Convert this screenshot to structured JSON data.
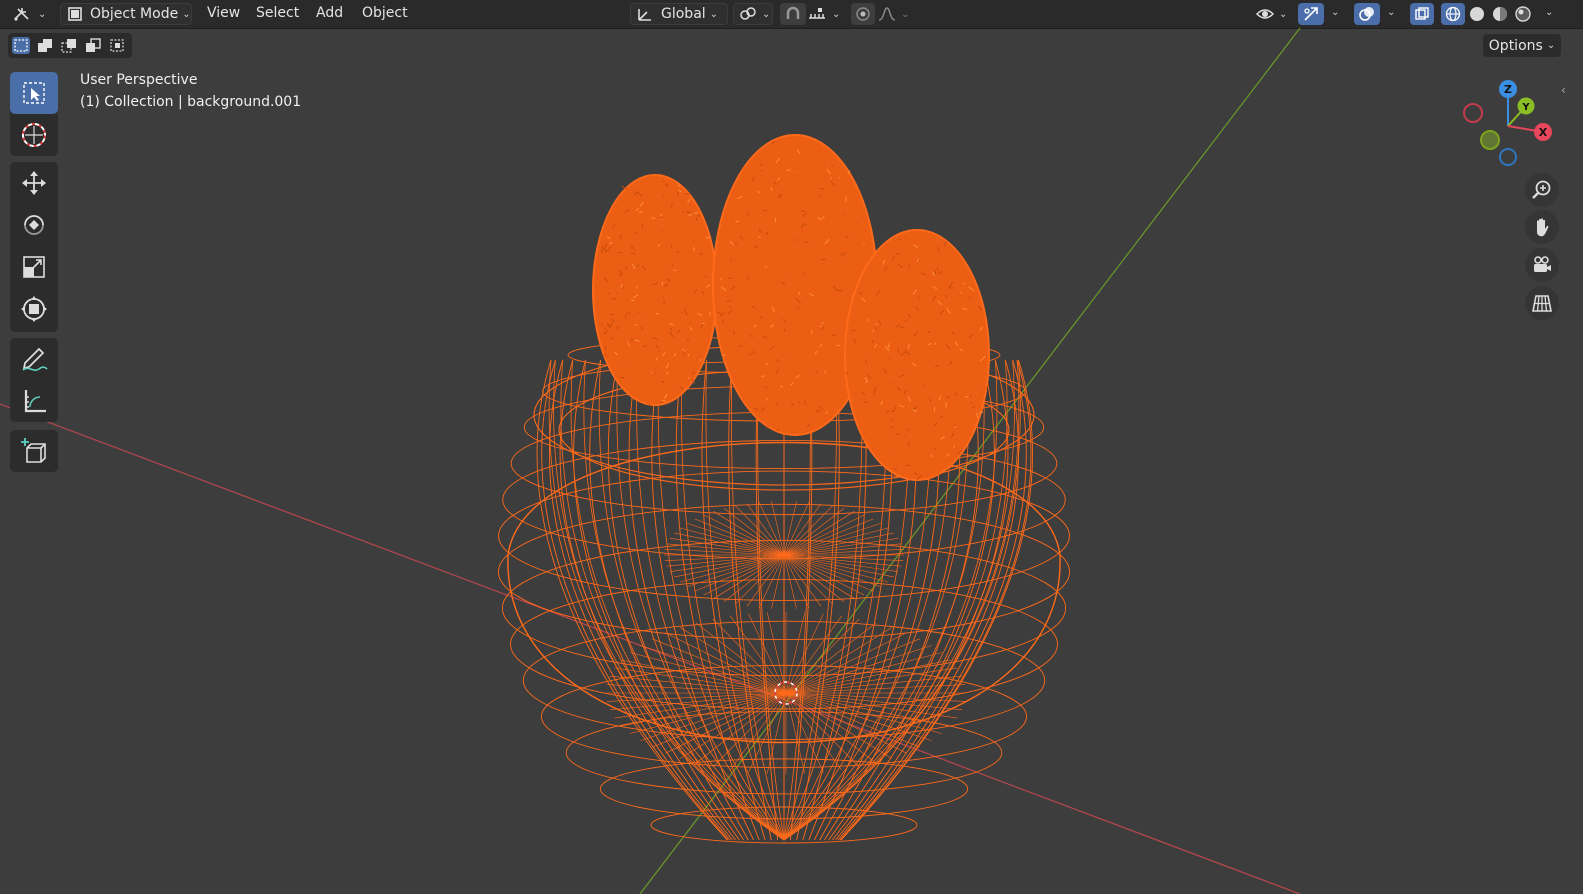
{
  "header": {
    "editor_type_icon": "editor-type-icon",
    "mode": "Object Mode",
    "menus": [
      "View",
      "Select",
      "Add",
      "Object"
    ],
    "transform_orientation": "Global",
    "options_label": "Options"
  },
  "viewport": {
    "perspective": "User Perspective",
    "collection": "(1) Collection | background.001"
  },
  "gizmo": {
    "axis_x": "X",
    "axis_y": "Y",
    "axis_z": "Z",
    "colors": {
      "x": "#e8465a",
      "y": "#8bbd25",
      "z": "#3b8fe2"
    }
  },
  "toolbar": {
    "tools": [
      "select-box-icon",
      "cursor-icon",
      "move-icon",
      "rotate-icon",
      "scale-icon",
      "transform-icon",
      "annotate-icon",
      "measure-icon",
      "add-cube-icon"
    ]
  },
  "colors": {
    "accent": "#4a6fa8",
    "wire": "#ff6a1a",
    "x_axis_line": "#b9474f",
    "y_axis_line": "#6b9a2a"
  }
}
